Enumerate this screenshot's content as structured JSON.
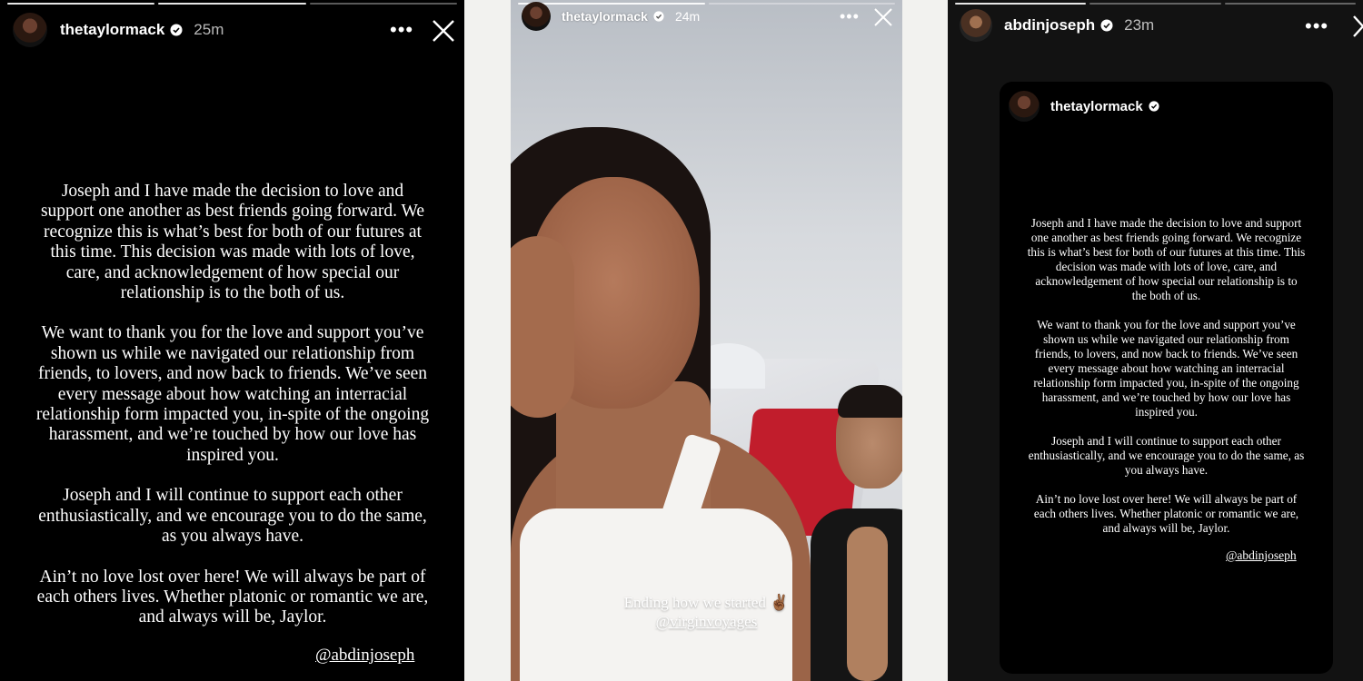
{
  "colors": {
    "background": "#f2f2ef",
    "story_bg": "#000000",
    "text": "#ffffff"
  },
  "story1": {
    "username": "thetaylormack",
    "verified": true,
    "time": "25m",
    "paragraphs": [
      "Joseph and I have made the decision to love and support one another as best friends going forward. We recognize this is what’s best for both of our futures at this time. This decision was made with lots of love, care, and acknowledgement of how special our relationship is to the both of us.",
      "We want to thank you for the love and support you’ve shown us while we navigated our relationship from friends, to lovers, and now back to friends. We’ve seen every message about how watching an interracial relationship form impacted you, in-spite of the ongoing harassment, and we’re touched by how our love has inspired you.",
      "Joseph and I will continue to support each other enthusiastically, and we encourage you to do the same, as you always have.",
      "Ain’t no love lost over here! We will always be part of each others lives. Whether platonic or romantic we are, and always will be, Jaylor."
    ],
    "mention": "@abdinjoseph"
  },
  "story2": {
    "username": "thetaylormack",
    "verified": true,
    "time": "24m",
    "caption": "Ending how we started ✌🏾",
    "mention": "@virginvoyages"
  },
  "story3": {
    "username": "abdinjoseph",
    "verified": true,
    "time": "23m",
    "shared_post": {
      "username": "thetaylormack",
      "verified": true,
      "paragraphs": [
        "Joseph and I have made the decision to love and support one another as best friends going forward. We recognize this is what’s best for both of our futures at this time. This decision was made with lots of love, care, and acknowledgement of how special our relationship is to the both of us.",
        "We want to thank you for the love and support you’ve shown us while we navigated our relationship from friends, to lovers, and now back to friends. We’ve seen every message about how watching an interracial relationship form impacted you, in-spite of the ongoing harassment, and we’re touched by how our love has inspired you.",
        "Joseph and I will continue to support each other enthusiastically, and we encourage you to do the same, as you always have.",
        "Ain’t no love lost over here! We will always be part of each others lives. Whether platonic or romantic we are, and always will be, Jaylor."
      ],
      "mention": "@abdinjoseph"
    }
  }
}
